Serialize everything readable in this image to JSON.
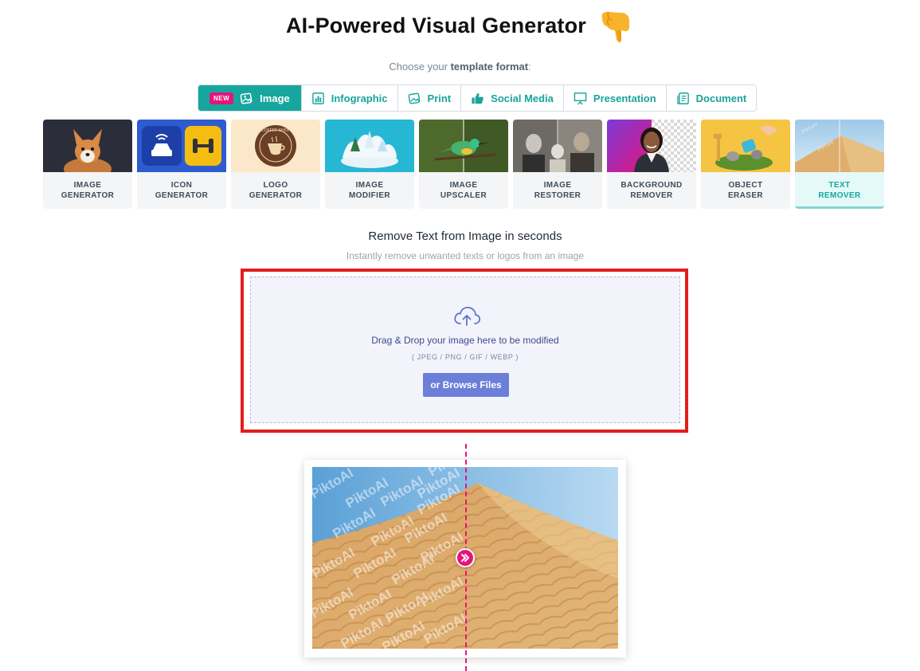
{
  "header": {
    "title": "AI-Powered Visual Generator",
    "hand_icon": "pointing-down-hand-emoji",
    "subtitle_prefix": "Choose your ",
    "subtitle_bold": "template format",
    "subtitle_suffix": ":"
  },
  "tabs": [
    {
      "label": "Image",
      "icon": "image-icon",
      "badge": "NEW",
      "active": true
    },
    {
      "label": "Infographic",
      "icon": "bar-chart-icon",
      "active": false
    },
    {
      "label": "Print",
      "icon": "print-icon",
      "active": false
    },
    {
      "label": "Social Media",
      "icon": "thumbs-up-icon",
      "active": false
    },
    {
      "label": "Presentation",
      "icon": "presentation-icon",
      "active": false
    },
    {
      "label": "Document",
      "icon": "document-icon",
      "active": false
    }
  ],
  "tools": [
    {
      "label": "IMAGE\nGENERATOR",
      "active": false
    },
    {
      "label": "ICON\nGENERATOR",
      "active": false
    },
    {
      "label": "LOGO\nGENERATOR",
      "active": false,
      "logo_text": "COFFEE SHOP"
    },
    {
      "label": "IMAGE\nMODIFIER",
      "active": false
    },
    {
      "label": "IMAGE\nUPSCALER",
      "active": false
    },
    {
      "label": "IMAGE\nRESTORER",
      "active": false
    },
    {
      "label": "BACKGROUND\nREMOVER",
      "active": false
    },
    {
      "label": "OBJECT\nERASER",
      "active": false
    },
    {
      "label": "TEXT\nREMOVER",
      "active": true,
      "watermark": "PiktoAI"
    }
  ],
  "section": {
    "title": "Remove Text from Image in seconds",
    "subtitle": "Instantly remove unwanted texts or logos from an image"
  },
  "upload": {
    "icon": "cloud-upload-icon",
    "drop_text": "Drag & Drop your image here to be modified",
    "formats": "( JPEG / PNG / GIF / WEBP )",
    "browse_label": "or Browse Files"
  },
  "preview": {
    "watermark_text": "PiktoAI",
    "handle_icon": "double-chevron-right-icon"
  },
  "colors": {
    "accent": "#17a69e",
    "highlight": "#e11d1d",
    "badge": "#e5157a",
    "button": "#6c7fd8"
  }
}
